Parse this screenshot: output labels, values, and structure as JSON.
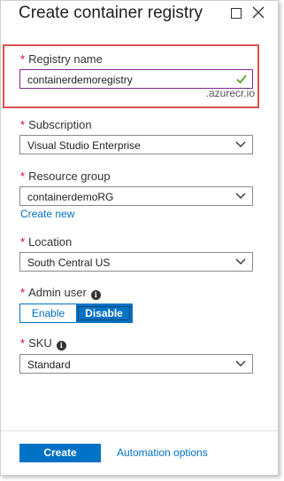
{
  "blade": {
    "title": "Create container registry"
  },
  "registry": {
    "label": "Registry name",
    "value": "containerdemoregistry",
    "suffix": ".azurecr.io"
  },
  "subscription": {
    "label": "Subscription",
    "value": "Visual Studio Enterprise"
  },
  "resource_group": {
    "label": "Resource group",
    "value": "containerdemoRG",
    "create_new": "Create new"
  },
  "location": {
    "label": "Location",
    "value": "South Central US"
  },
  "admin_user": {
    "label": "Admin user",
    "enable": "Enable",
    "disable": "Disable",
    "selected": "Disable"
  },
  "sku": {
    "label": "SKU",
    "value": "Standard"
  },
  "footer": {
    "create": "Create",
    "automation": "Automation options"
  },
  "colors": {
    "accent": "#0072c6",
    "required": "#e0001b",
    "highlight": "#d9534f",
    "valid": "#5fa22d"
  },
  "icons": {
    "maximize": "maximize-icon",
    "close": "close-icon",
    "valid": "checkmark-icon",
    "dropdown": "chevron-down-icon",
    "info": "info-icon"
  }
}
